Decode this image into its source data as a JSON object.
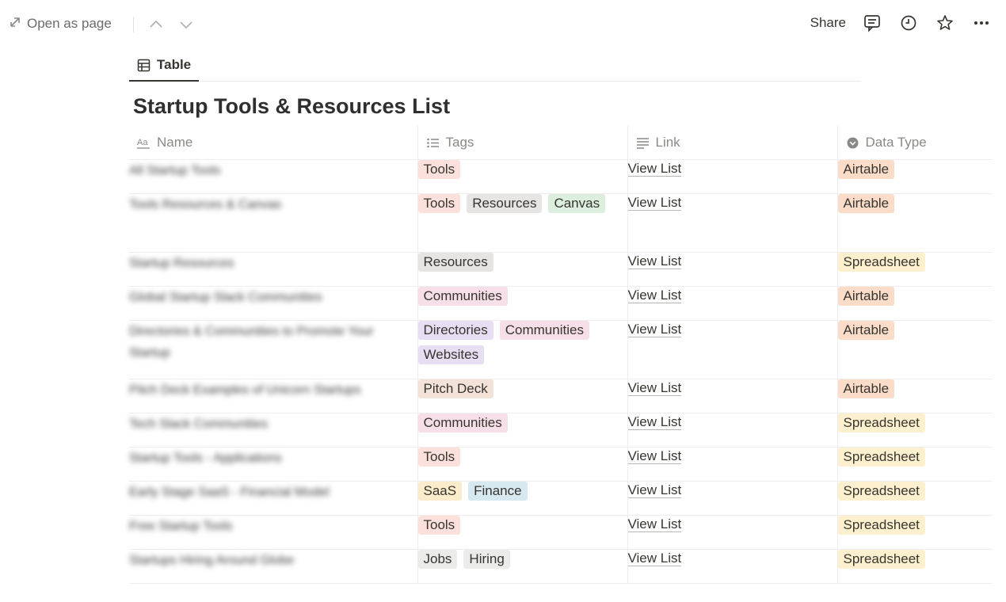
{
  "topbar": {
    "open_as_page": "Open as page",
    "share": "Share",
    "icons": [
      "open-as-page-icon",
      "chevron-up-icon",
      "chevron-down-icon",
      "comment-icon",
      "clock-icon",
      "star-icon",
      "more-icon"
    ]
  },
  "view": {
    "tab_label": "Table",
    "tab_icon": "table-icon"
  },
  "database": {
    "title": "Startup Tools & Resources List",
    "columns": [
      {
        "label": "Name",
        "icon": "text-property-icon"
      },
      {
        "label": "Tags",
        "icon": "multi-select-icon"
      },
      {
        "label": "Link",
        "icon": "text-lines-icon"
      },
      {
        "label": "Data Type",
        "icon": "select-icon"
      }
    ],
    "rows": [
      {
        "name": "All Startup Tools",
        "tags": [
          "Tools"
        ],
        "link": "View List",
        "type": "Airtable"
      },
      {
        "name": "Tools Resources & Canvas",
        "tags": [
          "Tools",
          "Resources",
          "Canvas"
        ],
        "link": "View List",
        "type": "Airtable"
      },
      {
        "name": "Startup Resources",
        "tags": [
          "Resources"
        ],
        "link": "View List",
        "type": "Spreadsheet"
      },
      {
        "name": "Global Startup Slack Communities",
        "tags": [
          "Communities"
        ],
        "link": "View List",
        "type": "Airtable"
      },
      {
        "name": "Directories & Communities to Promote Your Startup",
        "tags": [
          "Directories",
          "Communities",
          "Websites"
        ],
        "link": "View List",
        "type": "Airtable"
      },
      {
        "name": "Pitch Deck Examples of Unicorn Startups",
        "tags": [
          "Pitch Deck"
        ],
        "link": "View List",
        "type": "Airtable"
      },
      {
        "name": "Tech Slack Communities",
        "tags": [
          "Communities"
        ],
        "link": "View List",
        "type": "Spreadsheet"
      },
      {
        "name": "Startup Tools - Applications",
        "tags": [
          "Tools"
        ],
        "link": "View List",
        "type": "Spreadsheet"
      },
      {
        "name": "Early Stage SaaS - Financial Model",
        "tags": [
          "SaaS",
          "Finance"
        ],
        "link": "View List",
        "type": "Spreadsheet"
      },
      {
        "name": "Free Startup Tools",
        "tags": [
          "Tools"
        ],
        "link": "View List",
        "type": "Spreadsheet"
      },
      {
        "name": "Startups Hiring Around Globe",
        "tags": [
          "Jobs",
          "Hiring"
        ],
        "link": "View List",
        "type": "Spreadsheet"
      }
    ]
  },
  "tag_colors": {
    "Tools": "#fbe0dc",
    "Resources": "#e6e5e3",
    "Canvas": "#dcefdf",
    "Communities": "#f6dfe8",
    "Directories": "#e8def3",
    "Websites": "#e8def3",
    "Pitch Deck": "#f2e2d8",
    "SaaS": "#fbeccb",
    "Finance": "#d8e8f1",
    "Jobs": "#ebebea",
    "Hiring": "#ebebea"
  },
  "type_colors": {
    "Airtable": "#fadcc9",
    "Spreadsheet": "#fcf0cf"
  }
}
